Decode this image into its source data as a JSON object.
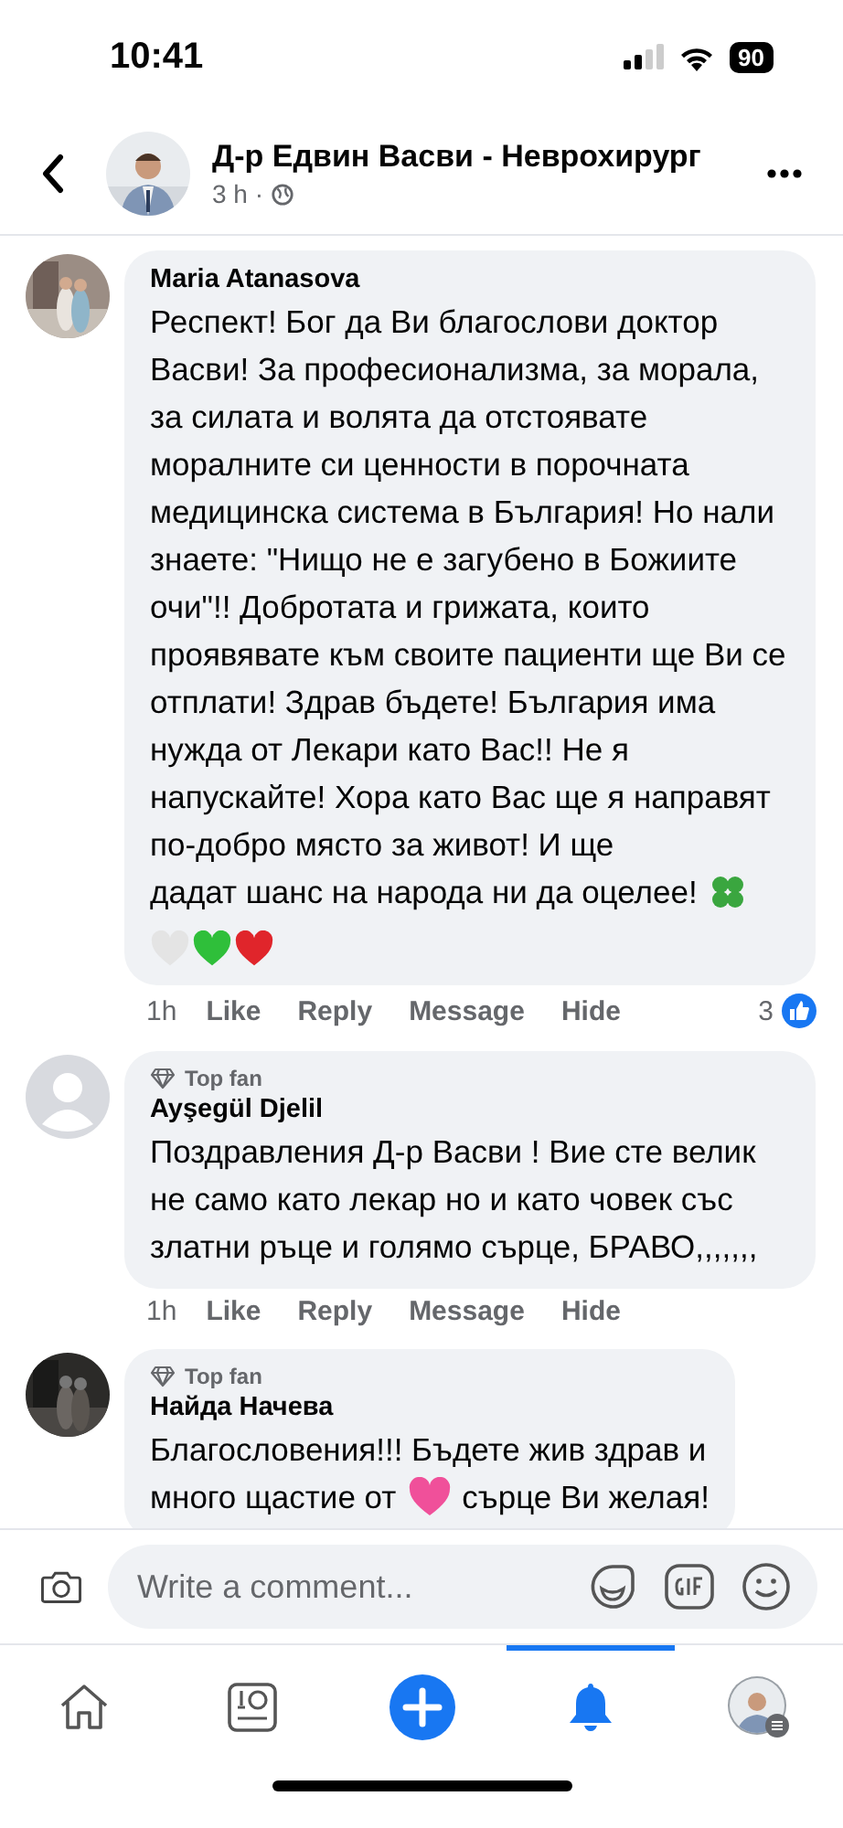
{
  "status_bar": {
    "time": "10:41",
    "battery": "90"
  },
  "header": {
    "title": "Д-р Едвин Васви - Неврохирург",
    "meta": "3 h ·"
  },
  "comments": [
    {
      "author": "Maria Atanasova",
      "body": "Респект! Бог да Ви благослови доктор Васви! За професионализма, за морала, за силата и волята да отстоявате моралните си ценности в порочната медицинска система в България!  Но нали знаете: \"Нищо не е загубено в Божиите очи\"!! Добротата и грижата, които проявявате към своите пациенти ще Ви се отплати! Здрав бъдете! България има нужда от Лекари като Вас!! Не я напускайте! Хора като Вас ще я направят по-добро място за живот! И ще",
      "body_cont": "дадат шанс на народа ни да оцелее!",
      "time": "1h",
      "actions": [
        "Like",
        "Reply",
        "Message",
        "Hide"
      ],
      "reactions": "3"
    },
    {
      "badge": "Top fan",
      "author": "Ayşegül Djelil",
      "body": "Поздравления Д-р Васви ! Вие сте велик не само като лекар но и като човек със златни ръце и голямо сърце, БРАВО,,,,,,,",
      "time": "1h",
      "actions": [
        "Like",
        "Reply",
        "Message",
        "Hide"
      ]
    },
    {
      "badge": "Top fan",
      "author": "Найда Начева",
      "body": "Благословения!!! Бъдете жив здрав и",
      "body_cont": "много щастие от",
      "body_after": "сърце Ви желая!"
    }
  ],
  "composer": {
    "placeholder": "Write a comment..."
  },
  "tabs": [
    {
      "selected": false
    },
    {
      "selected": false
    },
    {
      "selected": false
    },
    {
      "selected": true
    },
    {
      "selected": false
    }
  ]
}
